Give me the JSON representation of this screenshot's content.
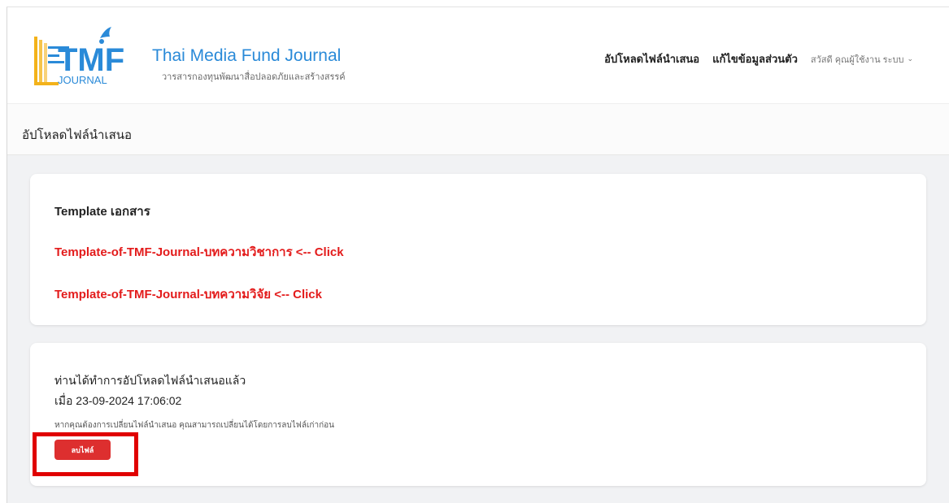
{
  "brand": {
    "logo_letters": "TMF",
    "logo_word": "JOURNAL",
    "title": "Thai Media Fund Journal",
    "subtitle": "วารสารกองทุนพัฒนาสื่อปลอดภัยและสร้างสรรค์"
  },
  "nav": {
    "upload": "อัปโหลดไฟล์นำเสนอ",
    "edit_profile": "แก้ไขข้อมูลส่วนตัว",
    "user": "สวัสดี คุณผู้ใช้งาน ระบบ"
  },
  "page": {
    "title": "อัปโหลดไฟล์นำเสนอ"
  },
  "templates": {
    "heading": "Template เอกสาร",
    "links": [
      "Template-of-TMF-Journal-บทความวิชาการ <-- Click",
      "Template-of-TMF-Journal-บทความวิจัย <-- Click"
    ]
  },
  "upload_status": {
    "line1": "ท่านได้ทำการอัปโหลดไฟล์นำเสนอแล้ว",
    "line2": "เมื่อ 23-09-2024 17:06:02",
    "note": "หากคุณต้องการเปลี่ยนไฟล์นำเสนอ คุณสามารถเปลี่ยนได้โดยการลบไฟล์เก่าก่อน",
    "delete_label": "ลบไฟล์"
  },
  "colors": {
    "accent_blue": "#2a8ad8",
    "link_red": "#e31b1b",
    "button_red": "#dd2f2f",
    "highlight_red": "#e00000"
  }
}
